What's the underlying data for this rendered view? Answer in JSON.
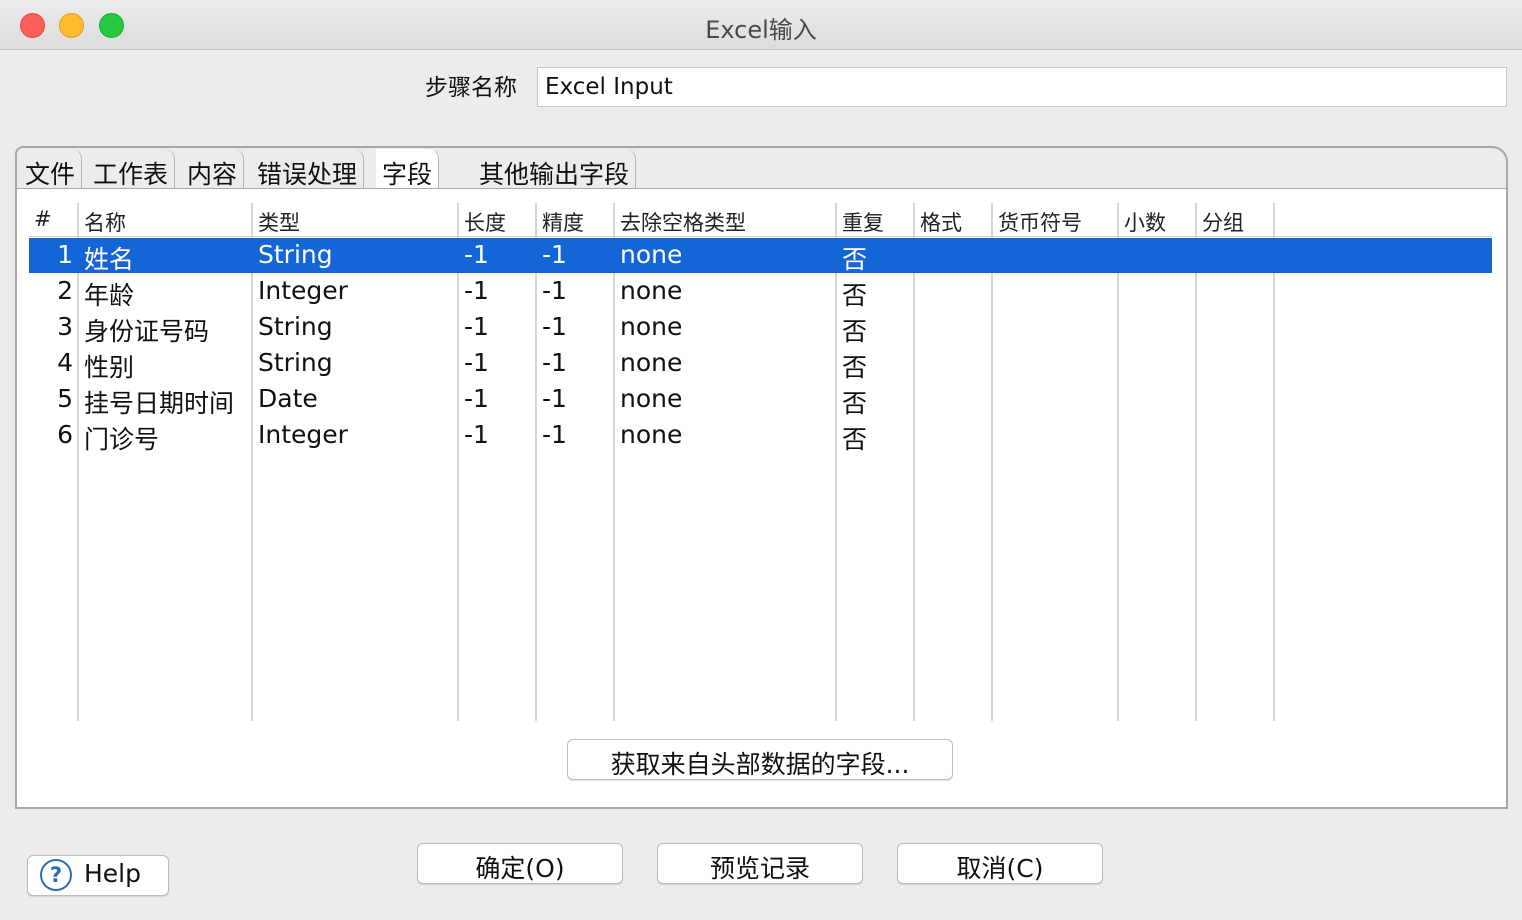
{
  "window": {
    "title": "Excel输入"
  },
  "step": {
    "label": "步骤名称",
    "value": "Excel Input"
  },
  "tabs": [
    {
      "label": "文件"
    },
    {
      "label": "工作表"
    },
    {
      "label": "内容"
    },
    {
      "label": "错误处理"
    },
    {
      "label": "字段",
      "active": true
    },
    {
      "label": "其他输出字段"
    }
  ],
  "table": {
    "columns": [
      "#",
      "名称",
      "类型",
      "长度",
      "精度",
      "去除空格类型",
      "重复",
      "格式",
      "货币符号",
      "小数",
      "分组"
    ],
    "rows": [
      {
        "num": "1",
        "name": "姓名",
        "type": "String",
        "length": "-1",
        "precision": "-1",
        "trim": "none",
        "repeat": "否",
        "selected": true
      },
      {
        "num": "2",
        "name": "年龄",
        "type": "Integer",
        "length": "-1",
        "precision": "-1",
        "trim": "none",
        "repeat": "否"
      },
      {
        "num": "3",
        "name": "身份证号码",
        "type": "String",
        "length": "-1",
        "precision": "-1",
        "trim": "none",
        "repeat": "否"
      },
      {
        "num": "4",
        "name": "性别",
        "type": "String",
        "length": "-1",
        "precision": "-1",
        "trim": "none",
        "repeat": "否"
      },
      {
        "num": "5",
        "name": "挂号日期时间",
        "type": "Date",
        "length": "-1",
        "precision": "-1",
        "trim": "none",
        "repeat": "否"
      },
      {
        "num": "6",
        "name": "门诊号",
        "type": "Integer",
        "length": "-1",
        "precision": "-1",
        "trim": "none",
        "repeat": "否"
      }
    ]
  },
  "buttons": {
    "get_fields": "获取来自头部数据的字段...",
    "help": "Help",
    "help_icon": "?",
    "ok": "确定(O)",
    "preview": "预览记录",
    "cancel": "取消(C)"
  },
  "colors": {
    "selection": "#1466d6",
    "close": "#fc5f57",
    "minimize": "#fdbc2e",
    "maximize": "#28c840"
  }
}
